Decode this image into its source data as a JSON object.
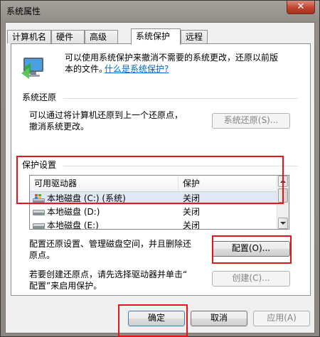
{
  "window": {
    "title": "系统属性"
  },
  "tabs": [
    {
      "label": "计算机名"
    },
    {
      "label": "硬件"
    },
    {
      "label": "高级"
    },
    {
      "label": "系统保护",
      "active": true
    },
    {
      "label": "远程"
    }
  ],
  "intro": {
    "line1": "可以使用系统保护来撤消不需要的系统更改，还原以前版",
    "line2": "本的文件。",
    "link": "什么是系统保护?",
    "icon": "computer-shield-icon"
  },
  "restore": {
    "heading": "系统还原",
    "line1": "可以通过将计算机还原到上一个还原点，",
    "line2": "撤消系统更改。",
    "button": "系统还原(S)..."
  },
  "protection": {
    "heading": "保护设置",
    "columns": [
      "可用驱动器",
      "保护"
    ],
    "rows": [
      {
        "drive": "本地磁盘 (C:) (系统)",
        "status": "关闭",
        "icon": "windows-drive-icon",
        "selected": true
      },
      {
        "drive": "本地磁盘 (D:)",
        "status": "关闭",
        "icon": "hard-drive-icon"
      },
      {
        "drive": "本地磁盘 (E:)",
        "status": "关闭",
        "icon": "hard-drive-icon"
      }
    ],
    "config_text1": "配置还原设置、管理磁盘空间，并且删除还",
    "config_text2": "原点。",
    "config_button": "配置(O)...",
    "create_text1": "若要创建还原点，请先选择驱动器并单击“",
    "create_text2": "配置”来启用保护。",
    "create_button": "创建(C)..."
  },
  "footer": {
    "ok": "确定",
    "cancel": "取消",
    "apply": "应用(A)"
  },
  "colors": {
    "highlight": "#e8141b",
    "link": "#0066cc"
  }
}
